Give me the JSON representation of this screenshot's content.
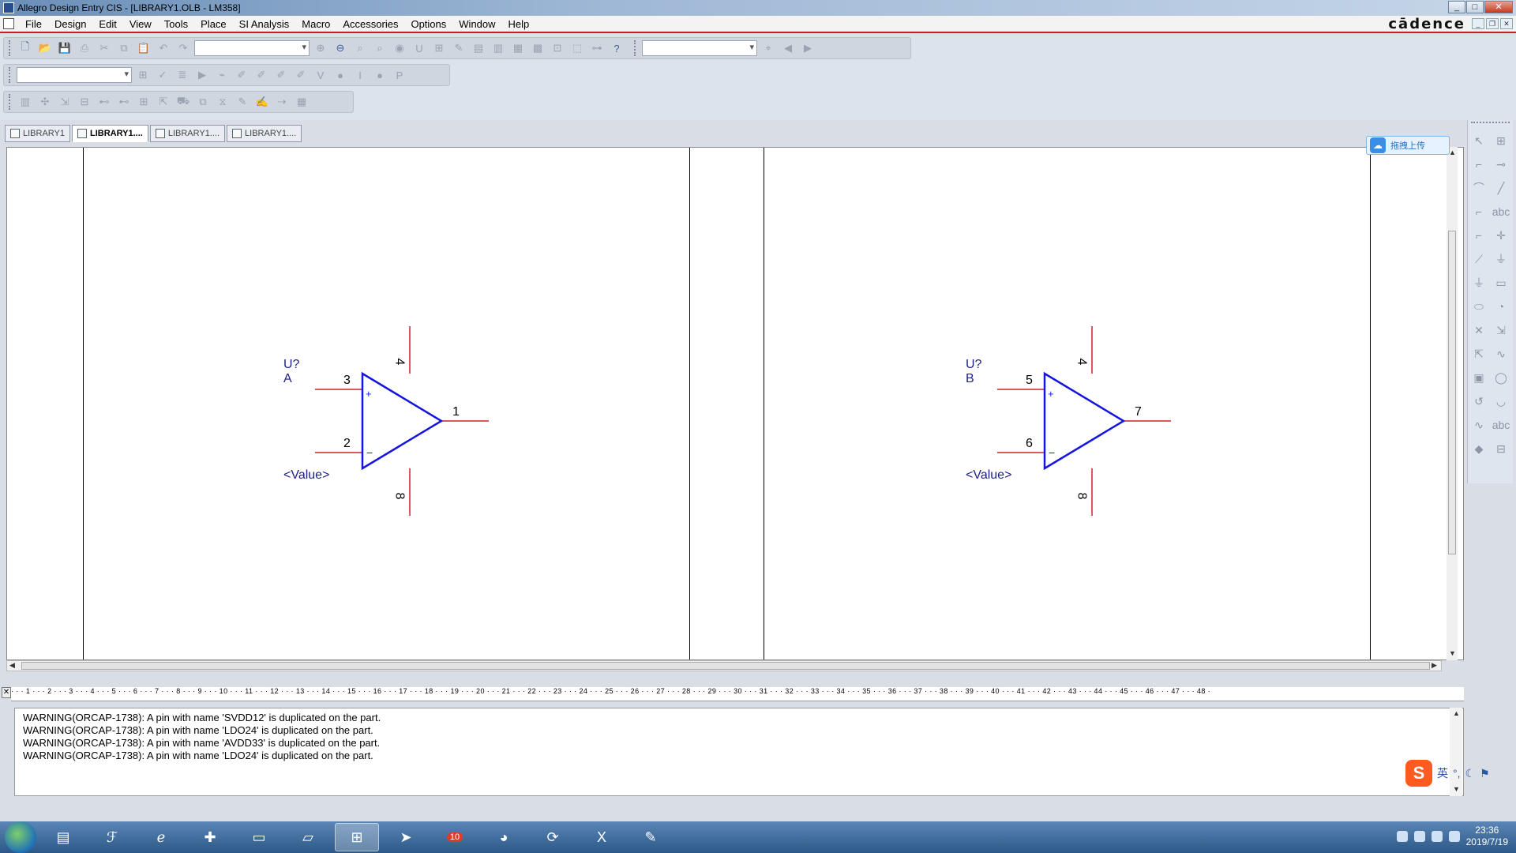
{
  "window": {
    "title": "Allegro Design Entry CIS - [LIBRARY1.OLB - LM358]",
    "buttons": [
      "_",
      "□",
      "✕"
    ]
  },
  "menu": {
    "items": [
      "File",
      "Design",
      "Edit",
      "View",
      "Tools",
      "Place",
      "SI Analysis",
      "Macro",
      "Accessories",
      "Options",
      "Window",
      "Help"
    ],
    "brand": "cādence",
    "mdi_buttons": [
      "_",
      "❐",
      "✕"
    ]
  },
  "toolbars": {
    "row1_icons": [
      "new-icon",
      "open-icon",
      "save-icon",
      "print-icon",
      "cut-icon",
      "copy-icon",
      "paste-icon",
      "undo-icon",
      "redo-icon",
      "zoom-in-icon",
      "zoom-out-icon",
      "zoom-area-icon",
      "zoom-all-icon",
      "help-icon",
      "find-icon",
      "back-icon",
      "forward-icon"
    ],
    "row2_icons": [
      "annotate-icon",
      "drc-icon",
      "netlist-icon",
      "bom-icon",
      "probe-icon",
      "marker-icon"
    ],
    "row3_icons": [
      "library-icon",
      "wizard-icon",
      "export-icon",
      "browse-icon",
      "table-icon"
    ]
  },
  "tabs": [
    {
      "label": "LIBRARY1",
      "active": false
    },
    {
      "label": "LIBRARY1....",
      "active": true
    },
    {
      "label": "LIBRARY1....",
      "active": false
    },
    {
      "label": "LIBRARY1....",
      "active": false
    }
  ],
  "parts": [
    {
      "ref": "U?A",
      "value": "<Value>",
      "pin_plus": "3",
      "pin_minus": "2",
      "pin_out": "1",
      "pin_top": "4",
      "pin_bottom": "8"
    },
    {
      "ref": "U?B",
      "value": "<Value>",
      "pin_plus": "5",
      "pin_minus": "6",
      "pin_out": "7",
      "pin_top": "4",
      "pin_bottom": "8"
    }
  ],
  "upload_badge": "拖拽上传",
  "log": {
    "lines": [
      "WARNING(ORCAP-1738): A pin with name 'SVDD12' is duplicated on the part.",
      "WARNING(ORCAP-1738): A pin with name 'LDO24' is duplicated on the part.",
      "WARNING(ORCAP-1738): A pin with name 'AVDD33' is duplicated on the part.",
      "WARNING(ORCAP-1738): A pin with name 'LDO24' is duplicated on the part."
    ],
    "ruler": "· · · 1 · · · 2 · · · 3 · · · 4 · · · 5 · · · 6 · · · 7 · · · 8 · · · 9 · · · 10 · · · 11 · · · 12 · · · 13 · · · 14 · · · 15 · · · 16 · · · 17 · · · 18 · · · 19 · · · 20 · · · 21 · · · 22 · · · 23 · · · 24 · · · 25 · · · 26 · · · 27 · · · 28 · · · 29 · · · 30 · · · 31 · · · 32 · · · 33 · · · 34 · · · 35 · · · 36 · · · 37 · · · 38 · · · 39 · · · 40 · · · 41 · · · 42 · · · 43 · · · 44 · · · 45 · · · 46 · · · 47 · · · 48 ·"
  },
  "ime": {
    "lang": "英"
  },
  "taskbar": {
    "apps": [
      "book-icon",
      "foxit-icon",
      "ie-icon",
      "360-icon",
      "explorer-icon",
      "notes-icon",
      "orcad-icon",
      "pointer-icon",
      "badge-icon",
      "wechat-icon",
      "refresh-icon",
      "excel-icon",
      "edit-icon"
    ],
    "badge_count": "10",
    "time": "23:36",
    "date": "2019/7/19"
  }
}
